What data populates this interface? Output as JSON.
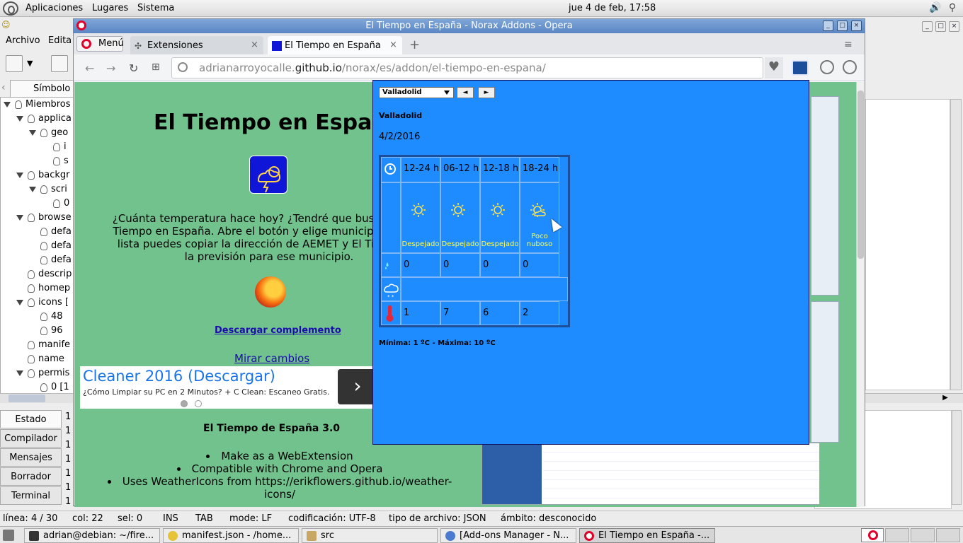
{
  "top_panel": {
    "menu_items": [
      "Aplicaciones",
      "Lugares",
      "Sistema"
    ],
    "clock": "jue  4 de feb, 17:58"
  },
  "geany": {
    "menu": [
      "Archivo",
      "Edita"
    ],
    "symbols_tab": "Símbolo",
    "tree": [
      {
        "label": "Miembros",
        "depth": 0,
        "arrow": true
      },
      {
        "label": "applica",
        "depth": 1,
        "arrow": true
      },
      {
        "label": "geo",
        "depth": 2,
        "arrow": true
      },
      {
        "label": "i",
        "depth": 3,
        "arrow": false
      },
      {
        "label": "s",
        "depth": 3,
        "arrow": false
      },
      {
        "label": "backgr",
        "depth": 1,
        "arrow": true
      },
      {
        "label": "scri",
        "depth": 2,
        "arrow": true
      },
      {
        "label": "0",
        "depth": 3,
        "arrow": false
      },
      {
        "label": "browse",
        "depth": 1,
        "arrow": true
      },
      {
        "label": "defa",
        "depth": 2,
        "arrow": false
      },
      {
        "label": "defa",
        "depth": 2,
        "arrow": false
      },
      {
        "label": "defa",
        "depth": 2,
        "arrow": false
      },
      {
        "label": "descrip",
        "depth": 1,
        "arrow": false
      },
      {
        "label": "homep",
        "depth": 1,
        "arrow": false
      },
      {
        "label": "icons [",
        "depth": 1,
        "arrow": true
      },
      {
        "label": "48",
        "depth": 2,
        "arrow": false
      },
      {
        "label": "96",
        "depth": 2,
        "arrow": false
      },
      {
        "label": "manife",
        "depth": 1,
        "arrow": false
      },
      {
        "label": "name",
        "depth": 1,
        "arrow": false
      },
      {
        "label": "permis",
        "depth": 1,
        "arrow": true
      },
      {
        "label": "0 [1",
        "depth": 2,
        "arrow": false
      }
    ],
    "message_tabs": [
      "Estado",
      "Compilador",
      "Mensajes",
      "Borrador",
      "Terminal"
    ],
    "message_lines": [
      "1",
      "1",
      "1",
      "1",
      "1",
      "1",
      "1"
    ],
    "statusbar": {
      "line": "línea: 4 / 30",
      "col": "col: 22",
      "sel": "sel: 0",
      "ins": "INS",
      "tab": "TAB",
      "mode": "mode: LF",
      "encoding": "codificación: UTF-8",
      "filetype": "tipo de archivo: JSON",
      "scope": "ámbito: desconocido"
    }
  },
  "opera": {
    "window_title": "El Tiempo en España - Norax Addons - Opera",
    "menu_button": "Menú",
    "tabs": [
      {
        "label": "Extensiones",
        "active": false
      },
      {
        "label": "El Tiempo en España",
        "active": true
      }
    ],
    "url_host": "adrianarroyocalle.",
    "url_domain": "github.io",
    "url_path": "/norax/es/addon/el-tiempo-en-espana/"
  },
  "page": {
    "title": "El Tiempo en España",
    "intro": "¿Cuánta temperatura hace hoy? ¿Tendré que buscar en Go\nTiempo en España. Abre el botón y elige municipio, si el tu\nlista puedes copiar la dirección de AEMET y El Tiempo de\nla previsión para ese municipio.",
    "download_link": "Descargar complemento",
    "changes_link": "Mirar cambios",
    "ad_title": "Cleaner 2016 (Descargar)",
    "ad_desc": "¿Cómo Limpiar su PC en 2 Minutos? + C Clean: Escaneo Gratis.",
    "ad_button": "›",
    "subheading": "El Tiempo de España 3.0",
    "bullets": [
      "Make as a WebExtension",
      "Compatible with Chrome and Opera",
      "Uses WeatherIcons from https://erikflowers.github.io/weather-icons/"
    ]
  },
  "popup": {
    "selected_city": "Valladolid",
    "prev_label": "◄",
    "next_label": "►",
    "city": "Valladolid",
    "date": "4/2/2016",
    "periods": [
      "12-24 h",
      "06-12 h",
      "12-18 h",
      "18-24 h"
    ],
    "sky": [
      "Despejado",
      "Despejado",
      "Despejado",
      "Poco nuboso"
    ],
    "sky_icons": [
      "sun-icon",
      "sun-icon",
      "sun-icon",
      "sun-cloud-icon"
    ],
    "precipitation": [
      "0",
      "0",
      "0",
      "0"
    ],
    "temperature": [
      "1",
      "7",
      "6",
      "2"
    ],
    "minmax": "Mínima: 1 ºC - Máxima: 10 ºC"
  },
  "taskbar": {
    "items": [
      {
        "label": "adrian@debian: ~/fire...",
        "icon": "terminal-icon"
      },
      {
        "label": "manifest.json - /home...",
        "icon": "geany-icon"
      },
      {
        "label": "src",
        "icon": "folder-icon"
      },
      {
        "label": "[Add-ons Manager - N...",
        "icon": "firefox-icon"
      },
      {
        "label": "El Tiempo en España -...",
        "icon": "opera-icon"
      }
    ]
  },
  "colors": {
    "page_bg": "#72c28e",
    "popup_bg": "#1e8cff",
    "sky_text": "#ffff4d",
    "title_bar": "#5b86c3"
  }
}
